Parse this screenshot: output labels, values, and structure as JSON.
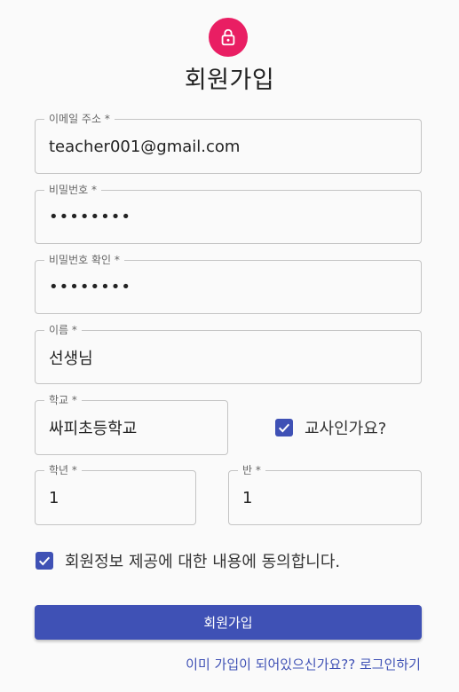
{
  "header": {
    "icon": "lock-icon",
    "title": "회원가입",
    "accent_color": "#e91e63"
  },
  "form": {
    "email": {
      "label": "이메일 주소 *",
      "value": "teacher001@gmail.com"
    },
    "password": {
      "label": "비밀번호 *",
      "value": "••••••••"
    },
    "password_confirm": {
      "label": "비밀번호 확인 *",
      "value": "••••••••"
    },
    "name": {
      "label": "이름 *",
      "value": "선생님"
    },
    "school": {
      "label": "학교 *",
      "value": "싸피초등학교"
    },
    "is_teacher": {
      "label": "교사인가요?",
      "checked": true
    },
    "grade": {
      "label": "학년 *",
      "value": "1"
    },
    "class_no": {
      "label": "반 *",
      "value": "1"
    },
    "agree": {
      "label": "회원정보 제공에 대한 내용에 동의합니다.",
      "checked": true
    },
    "submit_label": "회원가입",
    "login_link": "이미 가입이 되어있으신가요?? 로그인하기",
    "primary_color": "#3f51b5"
  }
}
